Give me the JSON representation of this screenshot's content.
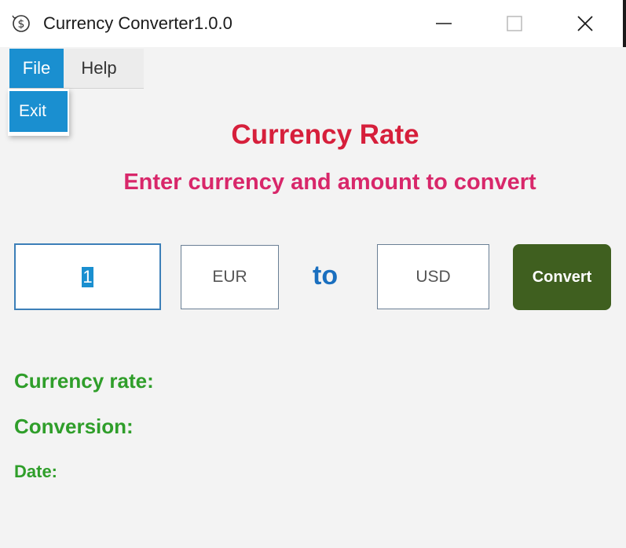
{
  "window": {
    "title": "Currency Converter1.0.0",
    "controls": {
      "minimize_icon": "minimize-icon",
      "maximize_icon": "maximize-icon",
      "close_icon": "close-icon"
    }
  },
  "menu": {
    "items": [
      {
        "label": "File",
        "active": true
      },
      {
        "label": "Help",
        "active": false
      }
    ],
    "file_dropdown": [
      {
        "label": "Exit",
        "highlighted": true
      }
    ]
  },
  "header": {
    "title": "Currency Rate",
    "subtitle": "Enter currency and amount to convert"
  },
  "form": {
    "amount_value": "1",
    "from_currency": "EUR",
    "to_label": "to",
    "to_currency": "USD",
    "convert_label": "Convert"
  },
  "results": {
    "rate_label": "Currency rate:",
    "conversion_label": "Conversion:",
    "date_label": "Date:"
  },
  "colors": {
    "accent_blue": "#1a8fd0",
    "title_red": "#d61f3b",
    "subtitle_pink": "#d8276a",
    "to_blue": "#1a6fbf",
    "convert_green": "#3f5f1f",
    "result_green": "#2f9e2a"
  }
}
